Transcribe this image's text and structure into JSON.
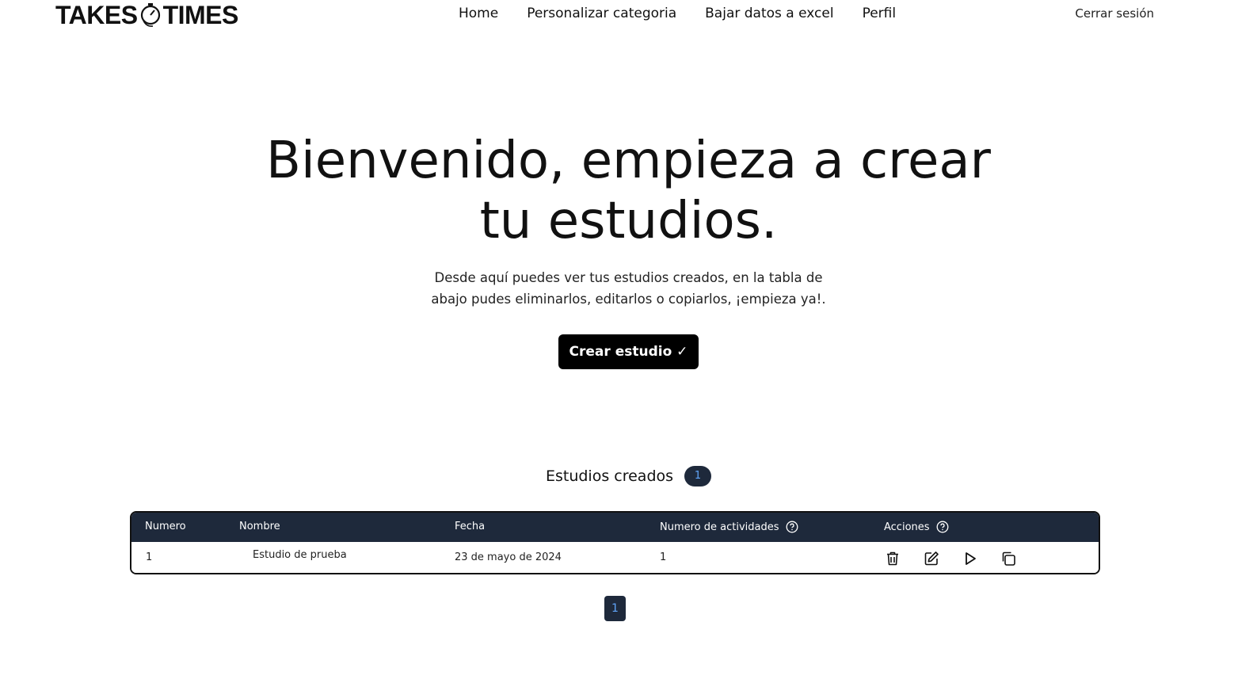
{
  "brand": {
    "left": "TAKES",
    "right": "TIMES"
  },
  "nav": {
    "home": "Home",
    "customize_category": "Personalizar categoria",
    "export_excel": "Bajar datos a excel",
    "profile": "Perfil",
    "logout": "Cerrar sesión"
  },
  "hero": {
    "title": "Bienvenido, empieza a crear tu estudios.",
    "subtitle": "Desde aquí puedes ver tus estudios creados, en la tabla de abajo pudes eliminarlos, editarlos o copiarlos, ¡empieza ya!.",
    "create_button": "Crear estudio ✓"
  },
  "studies": {
    "title": "Estudios creados",
    "count": "1",
    "columns": [
      "Numero",
      "Nombre",
      "Fecha",
      "Numero de actividades",
      "Acciones"
    ],
    "rows": [
      {
        "numero": "1",
        "nombre": "Estudio de prueba",
        "fecha": "23 de mayo de 2024",
        "actividades": "1"
      }
    ],
    "actions": [
      "trash-icon",
      "edit-icon",
      "play-icon",
      "copy-icon"
    ]
  },
  "pagination": {
    "current_page": "1"
  },
  "colors": {
    "header_bg": "#1e293b",
    "badge_text": "#60a5fa",
    "button_bg": "#000000"
  }
}
